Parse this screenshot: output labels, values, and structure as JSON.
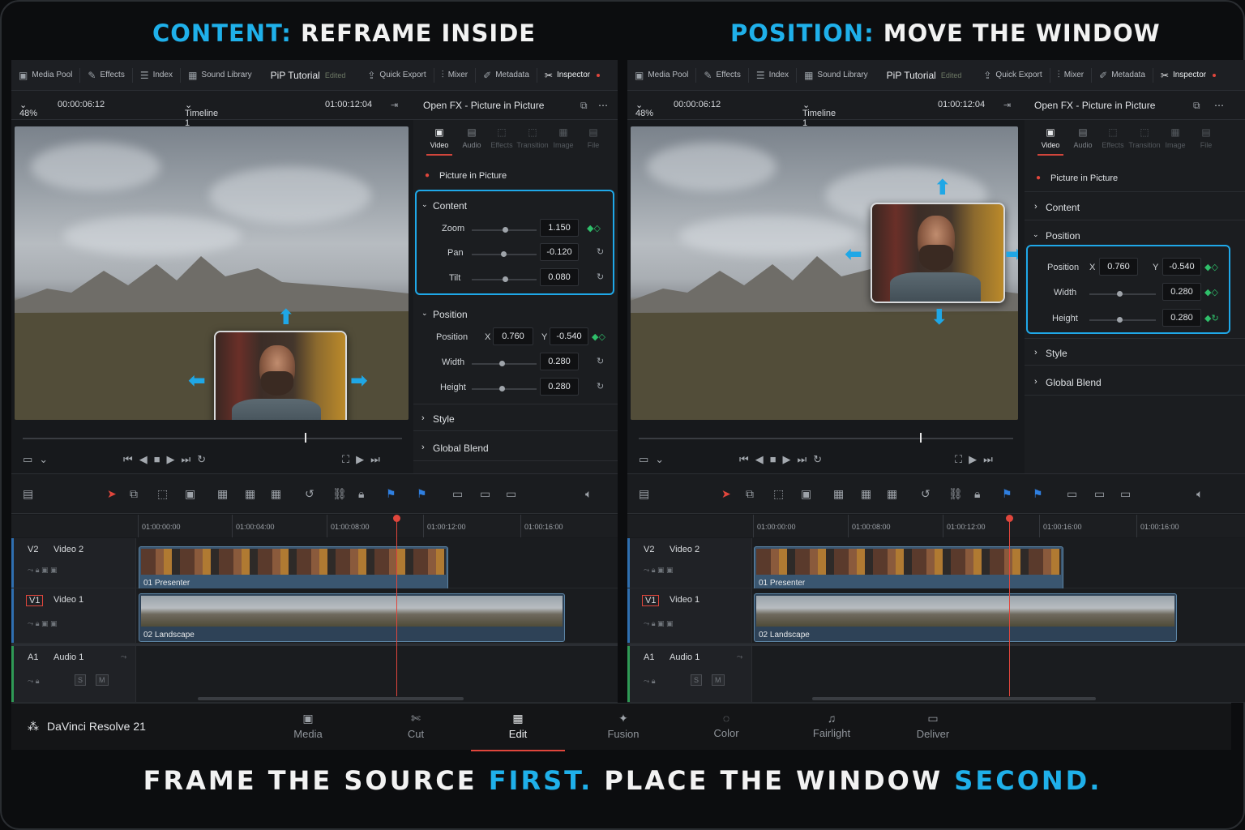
{
  "headline_left": {
    "accent": "CONTENT:",
    "rest": " REFRAME INSIDE"
  },
  "headline_right": {
    "accent": "POSITION:",
    "rest": " MOVE THE WINDOW"
  },
  "footer": {
    "p1": "FRAME THE SOURCE ",
    "a1": "FIRST.",
    "p2": " PLACE THE WINDOW ",
    "a2": "SECOND."
  },
  "menu": {
    "media_pool": "Media Pool",
    "effects": "Effects",
    "index": "Index",
    "sound_library": "Sound Library",
    "project_title": "PiP Tutorial",
    "edited": "Edited",
    "quick_export": "Quick Export",
    "mixer": "Mixer",
    "metadata": "Metadata",
    "inspector": "Inspector"
  },
  "viewer": {
    "zoom": "48%",
    "source_tc": "00:00:06:12",
    "timeline_name": "Timeline 1",
    "record_tc": "01:00:12:04"
  },
  "inspector": {
    "title": "Open FX - Picture in Picture",
    "tabs": [
      "Video",
      "Audio",
      "Effects",
      "Transition",
      "Image",
      "File"
    ],
    "effect_name": "Picture in Picture",
    "content": {
      "label": "Content",
      "zoom_label": "Zoom",
      "zoom": "1.150",
      "pan_label": "Pan",
      "pan": "-0.120",
      "tilt_label": "Tilt",
      "tilt": "0.080"
    },
    "position": {
      "label": "Position",
      "pos_label": "Position",
      "x_label": "X",
      "x": "0.760",
      "y_label": "Y",
      "y": "-0.540",
      "width_label": "Width",
      "width": "0.280",
      "height_label": "Height",
      "height": "0.280"
    },
    "style": "Style",
    "global_blend": "Global Blend"
  },
  "timeline": {
    "ruler_left": [
      "01:00:00:00",
      "01:00:04:00",
      "01:00:08:00",
      "01:00:12:00",
      "01:00:16:00"
    ],
    "ruler_right": [
      "01:00:00:00",
      "01:00:08:00",
      "01:00:12:00",
      "01:00:16:00",
      "01:00:16:00"
    ],
    "tracks": {
      "v2_id": "V2",
      "v2_name": "Video 2",
      "v1_id": "V1",
      "v1_name": "Video 1",
      "a1_id": "A1",
      "a1_name": "Audio 1",
      "solo": "S",
      "mute": "M"
    },
    "clip_v2": "01  Presenter",
    "clip_v1": "02  Landscape"
  },
  "app": {
    "name": "DaVinci Resolve 21"
  },
  "pages": [
    "Media",
    "Cut",
    "Edit",
    "Fusion",
    "Color",
    "Fairlight",
    "Deliver"
  ],
  "colors": {
    "accent": "#1fb0ea",
    "playhead": "#e0463c",
    "highlight": "#1fa8e8"
  }
}
